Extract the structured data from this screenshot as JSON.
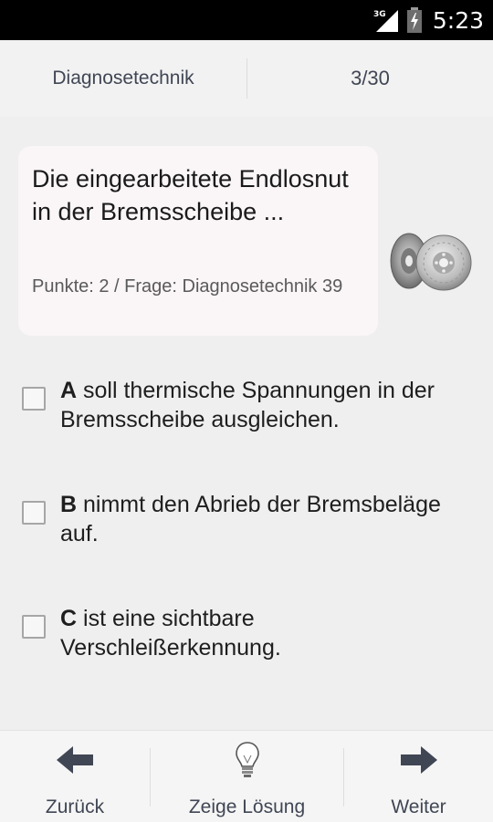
{
  "status_bar": {
    "network": "3G",
    "time": "5:23"
  },
  "header": {
    "category": "Diagnosetechnik",
    "progress": "3/30"
  },
  "question": {
    "text": "Die eingearbeitete Endlosnut in der Bremsscheibe ...",
    "meta": "Punkte: 2 / Frage: Diagnosetechnik 39",
    "image_icon": "brake-disc-image"
  },
  "answers": [
    {
      "letter": "A",
      "text": "soll thermische Spannungen in der Bremsscheibe ausgleichen.",
      "checked": false
    },
    {
      "letter": "B",
      "text": "nimmt den Abrieb der Bremsbeläge auf.",
      "checked": false
    },
    {
      "letter": "C",
      "text": "ist eine sichtbare Verschleißerkennung.",
      "checked": false
    }
  ],
  "toolbar": {
    "back_label": "Zurück",
    "back_icon": "arrow-left-icon",
    "solution_label": "Zeige Lösung",
    "solution_icon": "lightbulb-icon",
    "next_label": "Weiter",
    "next_icon": "arrow-right-icon"
  },
  "colors": {
    "background": "#efefef",
    "card": "#faf5f6",
    "text": "#1e1e1e",
    "muted": "#404654"
  }
}
